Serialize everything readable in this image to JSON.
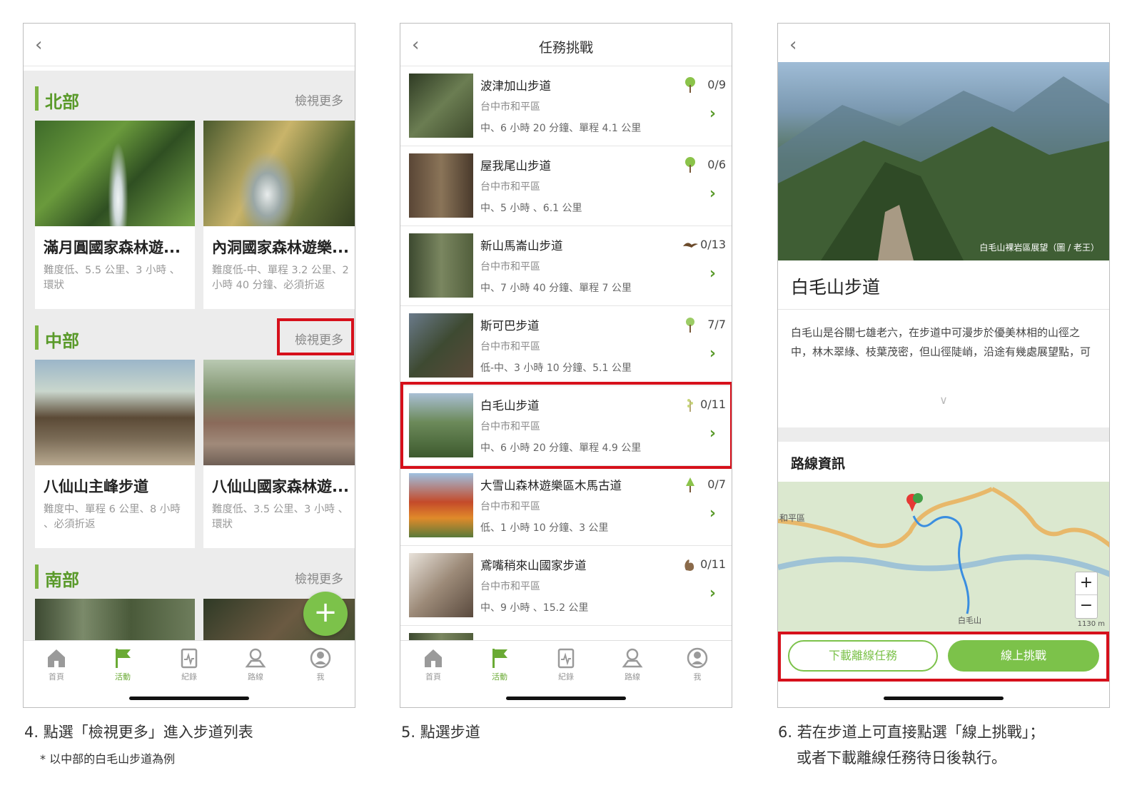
{
  "panel1": {
    "sections": [
      {
        "title": "北部",
        "more": "檢視更多",
        "cards": [
          {
            "title": "滿月圓國家森林遊...",
            "desc": "難度低、5.5 公里、3 小時 、環狀"
          },
          {
            "title": "內洞國家森林遊樂...",
            "desc": "難度低-中、單程 3.2 公里、2 小時 40 分鐘、必須折返"
          }
        ]
      },
      {
        "title": "中部",
        "more": "檢視更多",
        "cards": [
          {
            "title": "八仙山主峰步道",
            "desc": "難度中、單程 6 公里、8 小時 、必須折返"
          },
          {
            "title": "八仙山國家森林遊...",
            "desc": "難度低、3.5 公里、3 小時 、環狀"
          }
        ]
      },
      {
        "title": "南部",
        "more": "檢視更多"
      }
    ],
    "fab": "+"
  },
  "tabs": [
    {
      "label": "首頁",
      "icon": "home-icon"
    },
    {
      "label": "活動",
      "icon": "flag-icon"
    },
    {
      "label": "紀錄",
      "icon": "record-icon"
    },
    {
      "label": "路線",
      "icon": "route-pin-icon"
    },
    {
      "label": "我",
      "icon": "user-icon"
    }
  ],
  "panel2": {
    "title": "任務挑戰",
    "trails": [
      {
        "name": "波津加山步道",
        "location": "台中市和平區",
        "info": "中、6 小時 20 分鐘、單程 4.1 公里",
        "count": "0/9",
        "icon": "tree-icon"
      },
      {
        "name": "屋我尾山步道",
        "location": "台中市和平區",
        "info": "中、5 小時 、6.1 公里",
        "count": "0/6",
        "icon": "tree-icon"
      },
      {
        "name": "新山馬崙山步道",
        "location": "台中市和平區",
        "info": "中、7 小時 40 分鐘、單程 7 公里",
        "count": "0/13",
        "icon": "bird-icon"
      },
      {
        "name": "斯可巴步道",
        "location": "台中市和平區",
        "info": "低-中、3 小時 10 分鐘、5.1 公里",
        "count": "7/7",
        "icon": "tree-icon"
      },
      {
        "name": "白毛山步道",
        "location": "台中市和平區",
        "info": "中、6 小時 20 分鐘、單程 4.9 公里",
        "count": "0/11",
        "icon": "plant-icon"
      },
      {
        "name": "大雪山森林遊樂區木馬古道",
        "location": "台中市和平區",
        "info": "低、1 小時 10 分鐘、3 公里",
        "count": "0/7",
        "icon": "tree-icon"
      },
      {
        "name": "鳶嘴稍來山國家步道",
        "location": "台中市和平區",
        "info": "中、9 小時 、15.2 公里",
        "count": "0/11",
        "icon": "squirrel-icon"
      }
    ]
  },
  "panel3": {
    "photo_caption": "白毛山裸岩區展望（圖 / 老王）",
    "title": "白毛山步道",
    "desc": "白毛山是谷關七雄老六，在步道中可漫步於優美林相的山徑之中，林木翠綠、枝葉茂密，但山徑陡峭，沿途有幾處展望點，可",
    "route_title": "路線資訊",
    "map": {
      "district": "和平區",
      "peak": "白毛山",
      "scale": "1130 m",
      "zoom_in": "+",
      "zoom_out": "−"
    },
    "btn_download": "下載離線任務",
    "btn_online": "線上挑戰"
  },
  "captions": {
    "step4": "4. 點選「檢視更多」進入步道列表",
    "step4_note": "* 以中部的白毛山步道為例",
    "step5": "5. 點選步道",
    "step6_line1": "6. 若在步道上可直接點選「線上挑戰」；",
    "step6_line2": "或者下載離線任務待日後執行。"
  },
  "colors": {
    "accent": "#7cc24a",
    "section_green": "#5a9a2a",
    "highlight": "#d6101b"
  }
}
